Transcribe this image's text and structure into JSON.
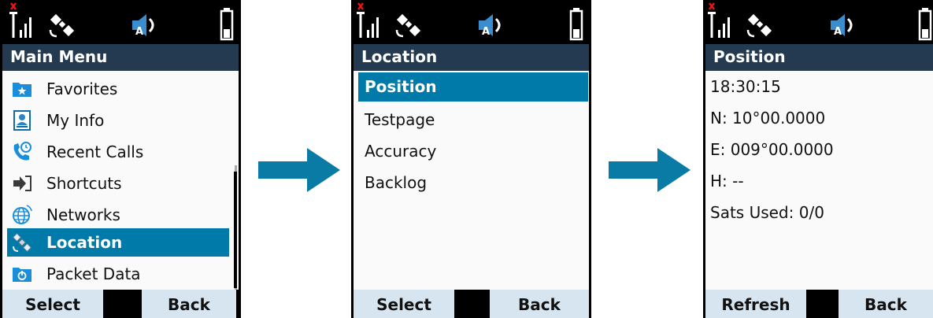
{
  "colors": {
    "title_bar": "#233a51",
    "selection": "#007aa8",
    "softkey": "#d6e5ef",
    "arrow": "#0a7ba5",
    "background": "#fafafa"
  },
  "screen_main_menu": {
    "title": "Main Menu",
    "items": [
      {
        "label": "Favorites",
        "icon": "star-folder-icon"
      },
      {
        "label": "My Info",
        "icon": "contact-card-icon"
      },
      {
        "label": "Recent Calls",
        "icon": "recent-calls-icon"
      },
      {
        "label": "Shortcuts",
        "icon": "shortcut-icon"
      },
      {
        "label": "Networks",
        "icon": "globe-icon"
      },
      {
        "label": "Location",
        "icon": "satellite-icon",
        "selected": true
      },
      {
        "label": "Packet Data",
        "icon": "packet-data-icon"
      }
    ],
    "softkeys": {
      "left": "Select",
      "right": "Back"
    }
  },
  "screen_location": {
    "title": "Location",
    "items": [
      {
        "label": "Position",
        "selected": true
      },
      {
        "label": "Testpage"
      },
      {
        "label": "Accuracy"
      },
      {
        "label": "Backlog"
      }
    ],
    "softkeys": {
      "left": "Select",
      "right": "Back"
    }
  },
  "screen_position": {
    "title": "Position",
    "lines": [
      "18:30:15",
      "N: 10°00.0000",
      "E: 009°00.0000",
      "H: --",
      "Sats Used: 0/0"
    ],
    "softkeys": {
      "left": "Refresh",
      "right": "Back"
    }
  }
}
